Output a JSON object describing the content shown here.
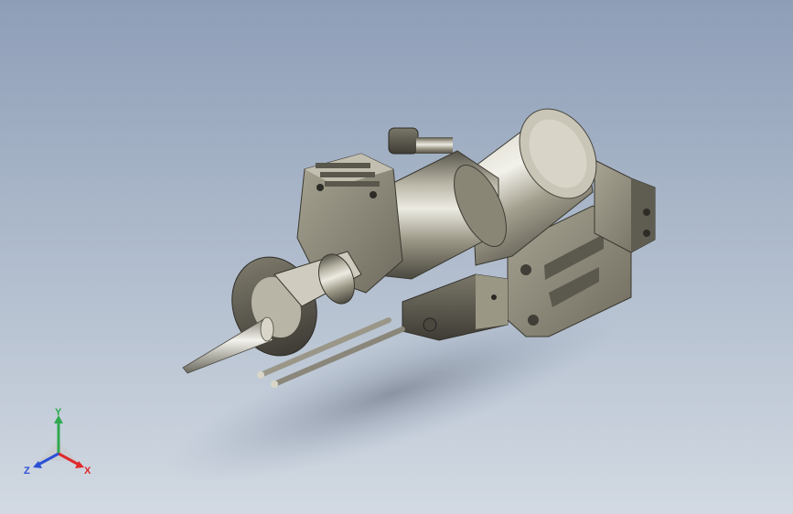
{
  "viewport": {
    "background_top": "#8e9eb7",
    "background_bottom": "#d2d9e2"
  },
  "model": {
    "body_color": "#8a8676",
    "highlight_color": "#e6e3d8",
    "shadow_color": "#4c4a41"
  },
  "triad": {
    "x_label": "X",
    "y_label": "Y",
    "z_label": "Z",
    "x_color": "#e0282b",
    "y_color": "#2fa84f",
    "z_color": "#2d4fd6"
  }
}
